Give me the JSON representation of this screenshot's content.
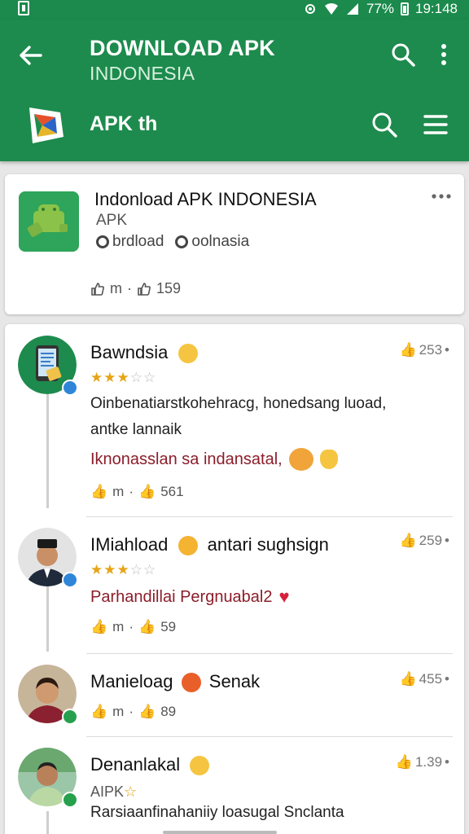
{
  "status_bar": {
    "battery": "77%",
    "time": "19:148"
  },
  "top_bar": {
    "title": "DOWNLOAD APK",
    "subtitle": "INDONESIA"
  },
  "brand_bar": {
    "brand": "APK th"
  },
  "app_card": {
    "name": "Indonload APK INDONESIA",
    "type": "APK",
    "meta_1": "brdload",
    "meta_2": "oolnasia",
    "stat_1": "m",
    "stat_2": "159"
  },
  "reviews": [
    {
      "name": "Bawndsia",
      "likes": "253",
      "stars": 3,
      "text_line_1": "Oinbenatiarstkohehracg, honedsang luoad,",
      "text_line_2": "antke lannaik",
      "text_red": "Iknonasslan sa indansatal,",
      "stat_1": "m",
      "stat_2": "561"
    },
    {
      "name": "IMiahload",
      "name_suffix": "antari sughsign",
      "likes": "259",
      "stars": 3,
      "text_red": "Parhandillai Pergnuabal2",
      "stat_1": "m",
      "stat_2": "59"
    },
    {
      "name": "Manieloag",
      "name_suffix": "Senak",
      "likes": "455",
      "stat_1": "m",
      "stat_2": "89"
    },
    {
      "name": "Denanlakal",
      "likes": "1.39",
      "tag": "AIPK",
      "text_line_1": "Rarsiaanfinahaniiy loasugal Snclanta"
    }
  ],
  "colors": {
    "brand_green": "#1d8b4d",
    "star": "#e6a417",
    "red_text": "#8c1d2a"
  }
}
